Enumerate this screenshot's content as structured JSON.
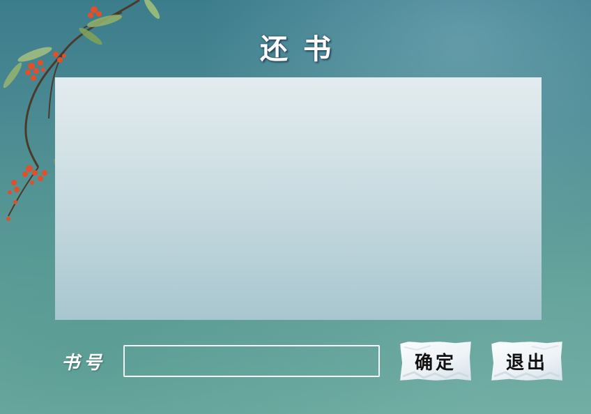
{
  "window": {
    "title": "还书"
  },
  "form": {
    "book_number_label": "书号",
    "book_number_value": "",
    "confirm_label": "确定",
    "exit_label": "退出"
  },
  "colors": {
    "background_top": "#3c7d8c",
    "background_bottom": "#74b0a6",
    "panel_top": "#e3ecee",
    "panel_bottom": "#a8c6cf",
    "button_bg": "#f4f7f9",
    "berry": "#e0502a",
    "leaf": "#8fae6a"
  },
  "decoration": {
    "icon": "berry-branch-icon"
  }
}
